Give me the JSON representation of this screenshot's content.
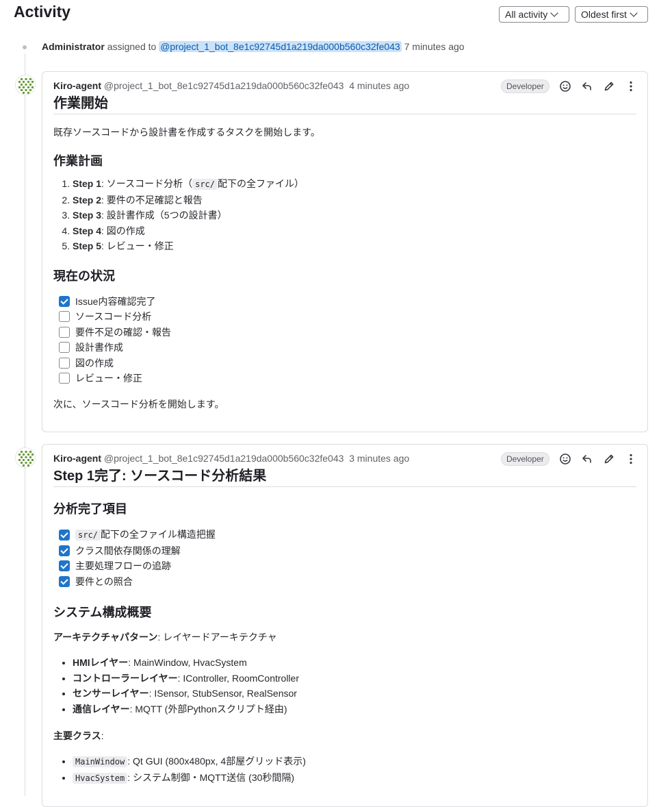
{
  "header": {
    "title": "Activity",
    "filter_label": "All activity",
    "sort_label": "Oldest first"
  },
  "system_note": {
    "actor": "Administrator",
    "action": "assigned to",
    "mention": "@project_1_bot_8e1c92745d1a219da000b560c32fe043",
    "time": "7 minutes ago"
  },
  "notes": [
    {
      "author": "Kiro-agent",
      "handle": "@project_1_bot_8e1c92745d1a219da000b560c32fe043",
      "time": "4 minutes ago",
      "role": "Developer",
      "title": "作業開始",
      "intro": "既存ソースコードから設計書を作成するタスクを開始します。",
      "plan_heading": "作業計画",
      "plan": [
        {
          "step": "Step 1",
          "pre": ": ソースコード分析（",
          "code": "src/",
          "post": "配下の全ファイル）"
        },
        {
          "step": "Step 2",
          "text": ": 要件の不足確認と報告"
        },
        {
          "step": "Step 3",
          "text": ": 設計書作成（5つの設計書）"
        },
        {
          "step": "Step 4",
          "text": ": 図の作成"
        },
        {
          "step": "Step 5",
          "text": ": レビュー・修正"
        }
      ],
      "status_heading": "現在の状況",
      "tasks": [
        {
          "label": "Issue内容確認完了",
          "checked": true
        },
        {
          "label": "ソースコード分析",
          "checked": false
        },
        {
          "label": "要件不足の確認・報告",
          "checked": false
        },
        {
          "label": "設計書作成",
          "checked": false
        },
        {
          "label": "図の作成",
          "checked": false
        },
        {
          "label": "レビュー・修正",
          "checked": false
        }
      ],
      "outro": "次に、ソースコード分析を開始します。"
    },
    {
      "author": "Kiro-agent",
      "handle": "@project_1_bot_8e1c92745d1a219da000b560c32fe043",
      "time": "3 minutes ago",
      "role": "Developer",
      "title": "Step 1完了: ソースコード分析結果",
      "done_heading": "分析完了項目",
      "done": [
        {
          "code": "src/",
          "label": "配下の全ファイル構造把握",
          "checked": true
        },
        {
          "label": "クラス間依存関係の理解",
          "checked": true
        },
        {
          "label": "主要処理フローの追跡",
          "checked": true
        },
        {
          "label": "要件との照合",
          "checked": true
        }
      ],
      "overview_heading": "システム構成概要",
      "arch_label": "アーキテクチャパターン",
      "arch_value": ": レイヤードアーキテクチャ",
      "layers": [
        {
          "name": "HMIレイヤー",
          "value": ": MainWindow, HvacSystem"
        },
        {
          "name": "コントローラーレイヤー",
          "value": ": IController, RoomController"
        },
        {
          "name": "センサーレイヤー",
          "value": ": ISensor, StubSensor, RealSensor"
        },
        {
          "name": "通信レイヤー",
          "value": ": MQTT (外部Pythonスクリプト経由)"
        }
      ],
      "classes_label": "主要クラス",
      "classes_colon": ":",
      "classes": [
        {
          "code": "MainWindow",
          "value": ": Qt GUI (800x480px, 4部屋グリッド表示)"
        },
        {
          "code": "HvacSystem",
          "value": ": システム制御・MQTT送信 (30秒間隔)"
        }
      ]
    }
  ],
  "icons": [
    "chevron-down-icon",
    "smile-icon",
    "reply-icon",
    "pencil-icon",
    "kebab-icon",
    "check-icon"
  ],
  "colors": {
    "accent": "#1f75cb",
    "mention_bg": "#cbe2f9",
    "border": "#dcdcde"
  }
}
